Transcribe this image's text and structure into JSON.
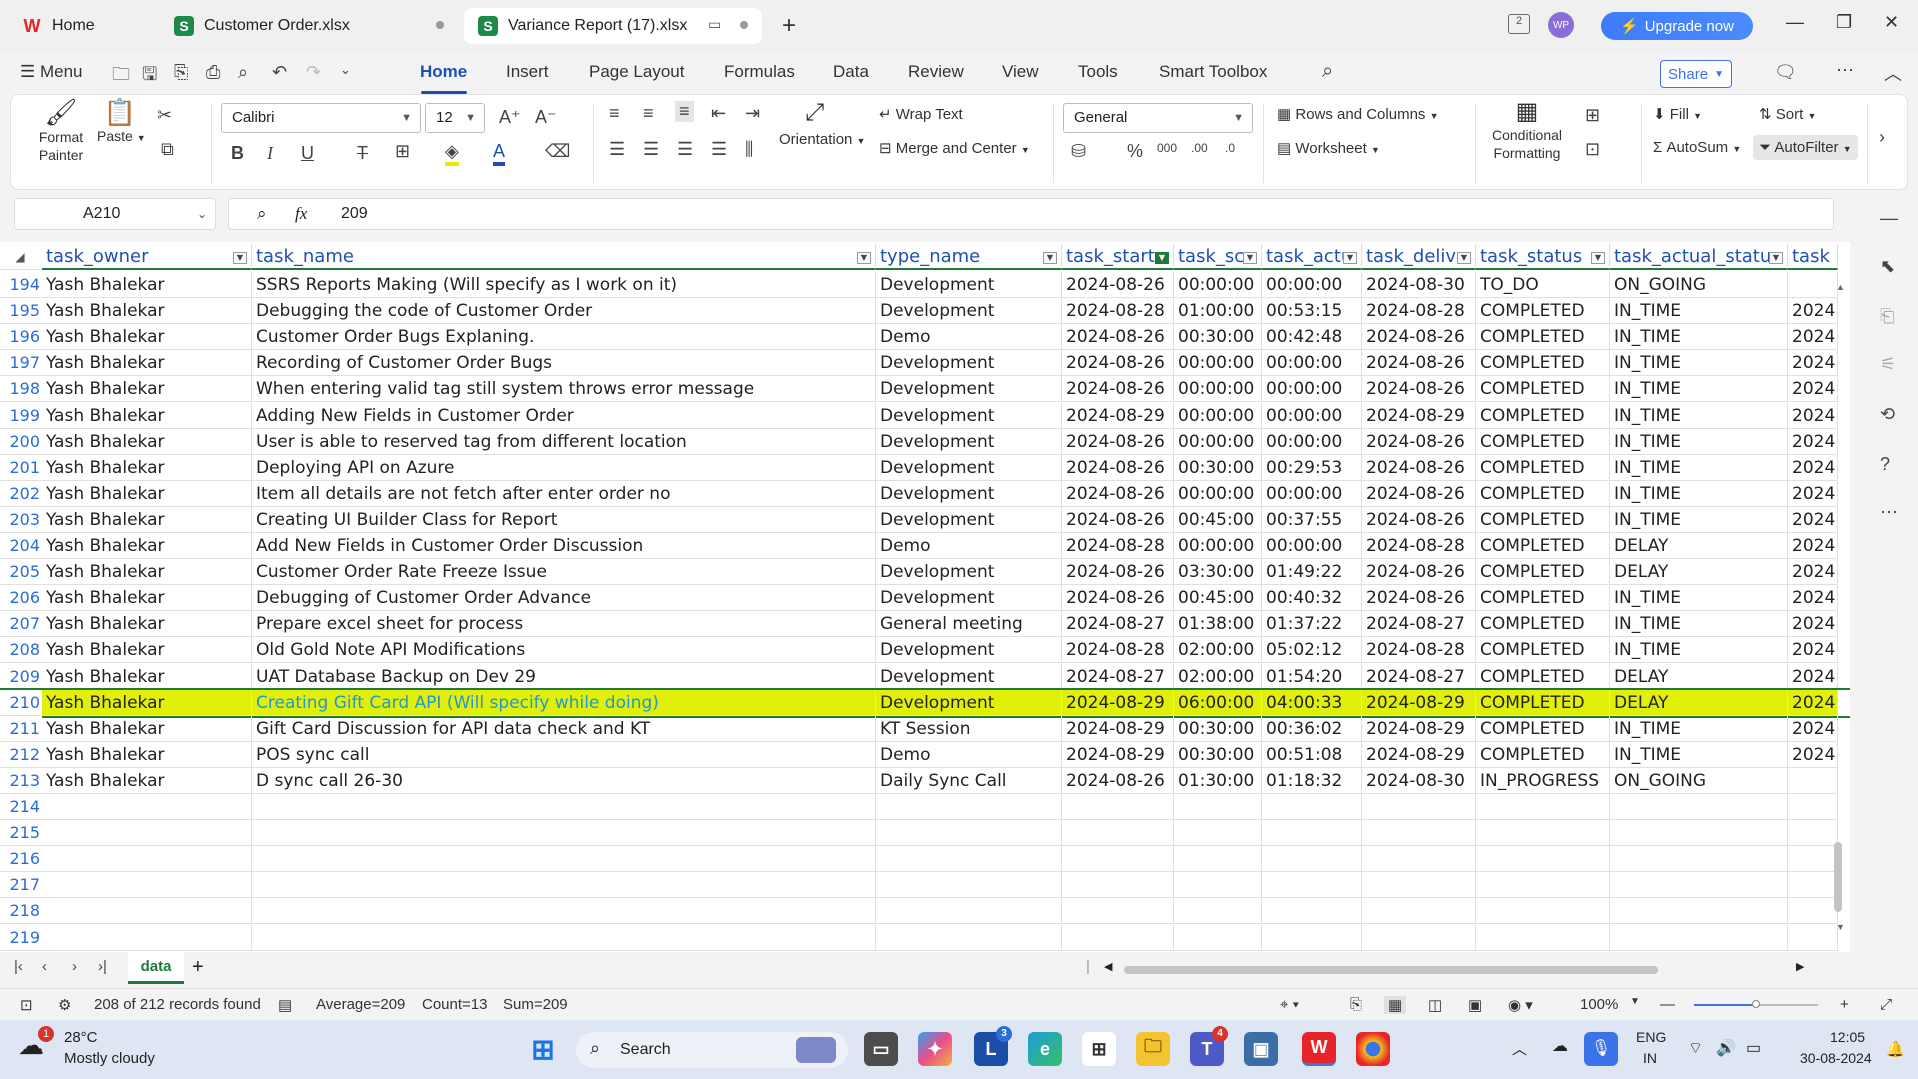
{
  "window": {
    "tabs": [
      {
        "label": "Home",
        "icon": "wps-logo-icon"
      },
      {
        "label": "Customer Order.xlsx",
        "icon": "sheet-icon"
      },
      {
        "label": "Variance Report (17).xlsx",
        "icon": "sheet-icon"
      }
    ],
    "upgrade_label": "Upgrade now",
    "account_initials": "WP"
  },
  "menubar": {
    "menu_label": "Menu",
    "items": [
      "Home",
      "Insert",
      "Page Layout",
      "Formulas",
      "Data",
      "Review",
      "View",
      "Tools",
      "Smart Toolbox"
    ],
    "share_label": "Share"
  },
  "ribbon": {
    "format_painter": "Format Painter",
    "paste": "Paste",
    "font_name": "Calibri",
    "font_size": "12",
    "wrap_text": "Wrap Text",
    "merge_center": "Merge and Center",
    "orientation": "Orientation",
    "number_format": "General",
    "rows_columns": "Rows and Columns",
    "worksheet": "Worksheet",
    "conditional_formatting": "Conditional Formatting",
    "fill": "Fill",
    "autosum": "AutoSum",
    "sort": "Sort",
    "autofilter": "AutoFilter"
  },
  "formula_bar": {
    "cell_ref": "A210",
    "fx": "fx",
    "value": "209"
  },
  "columns": [
    {
      "label": "task_owner",
      "filter": false
    },
    {
      "label": "task_name",
      "filter": false
    },
    {
      "label": "type_name",
      "filter": false
    },
    {
      "label": "task_start",
      "filter": true
    },
    {
      "label": "task_sc",
      "filter": false
    },
    {
      "label": "task_actu",
      "filter": false
    },
    {
      "label": "task_deliv",
      "filter": false
    },
    {
      "label": "task_status",
      "filter": false
    },
    {
      "label": "task_actual_status",
      "filter": false
    },
    {
      "label": "task",
      "filter": false
    }
  ],
  "rows": [
    {
      "n": "194",
      "c": [
        "Yash Bhalekar",
        "SSRS Reports Making (Will specify as I work on it)",
        "Development",
        "2024-08-26",
        "00:00:00",
        "00:00:00",
        "2024-08-30",
        "TO_DO",
        "ON_GOING",
        ""
      ]
    },
    {
      "n": "195",
      "c": [
        "Yash Bhalekar",
        "Debugging the code of Customer Order",
        "Development",
        "2024-08-28",
        "01:00:00",
        "00:53:15",
        "2024-08-28",
        "COMPLETED",
        "IN_TIME",
        "2024"
      ]
    },
    {
      "n": "196",
      "c": [
        "Yash Bhalekar",
        "Customer Order Bugs Explaning.",
        "Demo",
        "2024-08-26",
        "00:30:00",
        "00:42:48",
        "2024-08-26",
        "COMPLETED",
        "IN_TIME",
        "2024"
      ]
    },
    {
      "n": "197",
      "c": [
        "Yash Bhalekar",
        "Recording of Customer Order Bugs",
        "Development",
        "2024-08-26",
        "00:00:00",
        "00:00:00",
        "2024-08-26",
        "COMPLETED",
        "IN_TIME",
        "2024"
      ]
    },
    {
      "n": "198",
      "c": [
        "Yash Bhalekar",
        "When entering valid tag still system throws error message",
        "Development",
        "2024-08-26",
        "00:00:00",
        "00:00:00",
        "2024-08-26",
        "COMPLETED",
        "IN_TIME",
        "2024"
      ]
    },
    {
      "n": "199",
      "c": [
        "Yash Bhalekar",
        "Adding New Fields in Customer Order",
        "Development",
        "2024-08-29",
        "00:00:00",
        "00:00:00",
        "2024-08-29",
        "COMPLETED",
        "IN_TIME",
        "2024"
      ]
    },
    {
      "n": "200",
      "c": [
        "Yash Bhalekar",
        "User is able to reserved tag from  different  location",
        "Development",
        "2024-08-26",
        "00:00:00",
        "00:00:00",
        "2024-08-26",
        "COMPLETED",
        "IN_TIME",
        "2024"
      ]
    },
    {
      "n": "201",
      "c": [
        "Yash Bhalekar",
        "Deploying API on Azure",
        "Development",
        "2024-08-26",
        "00:30:00",
        "00:29:53",
        "2024-08-26",
        "COMPLETED",
        "IN_TIME",
        "2024"
      ]
    },
    {
      "n": "202",
      "c": [
        "Yash Bhalekar",
        "Item all details are not fetch  after enter order no",
        "Development",
        "2024-08-26",
        "00:00:00",
        "00:00:00",
        "2024-08-26",
        "COMPLETED",
        "IN_TIME",
        "2024"
      ]
    },
    {
      "n": "203",
      "c": [
        "Yash Bhalekar",
        "Creating UI Builder Class for Report",
        "Development",
        "2024-08-26",
        "00:45:00",
        "00:37:55",
        "2024-08-26",
        "COMPLETED",
        "IN_TIME",
        "2024"
      ]
    },
    {
      "n": "204",
      "c": [
        "Yash Bhalekar",
        "Add New Fields in Customer Order Discussion",
        "Demo",
        "2024-08-28",
        "00:00:00",
        "00:00:00",
        "2024-08-28",
        "COMPLETED",
        "DELAY",
        "2024"
      ]
    },
    {
      "n": "205",
      "c": [
        "Yash Bhalekar",
        "Customer Order Rate Freeze Issue",
        "Development",
        "2024-08-26",
        "03:30:00",
        "01:49:22",
        "2024-08-26",
        "COMPLETED",
        "DELAY",
        "2024"
      ]
    },
    {
      "n": "206",
      "c": [
        "Yash Bhalekar",
        "Debugging of Customer Order Advance",
        "Development",
        "2024-08-26",
        "00:45:00",
        "00:40:32",
        "2024-08-26",
        "COMPLETED",
        "IN_TIME",
        "2024"
      ]
    },
    {
      "n": "207",
      "c": [
        "Yash Bhalekar",
        "Prepare excel sheet for process",
        "General meeting",
        "2024-08-27",
        "01:38:00",
        "01:37:22",
        "2024-08-27",
        "COMPLETED",
        "IN_TIME",
        "2024"
      ]
    },
    {
      "n": "208",
      "c": [
        "Yash Bhalekar",
        "Old Gold Note API Modifications",
        "Development",
        "2024-08-28",
        "02:00:00",
        "05:02:12",
        "2024-08-28",
        "COMPLETED",
        "IN_TIME",
        "2024"
      ]
    },
    {
      "n": "209",
      "c": [
        "Yash Bhalekar",
        "UAT Database Backup on Dev 29",
        "Development",
        "2024-08-27",
        "02:00:00",
        "01:54:20",
        "2024-08-27",
        "COMPLETED",
        "DELAY",
        "2024"
      ]
    },
    {
      "n": "210",
      "c": [
        "Yash Bhalekar",
        "Creating Gift Card API (Will specify while doing)",
        "Development",
        "2024-08-29",
        "06:00:00",
        "04:00:33",
        "2024-08-29",
        "COMPLETED",
        "DELAY",
        "2024"
      ],
      "selected": true
    },
    {
      "n": "211",
      "c": [
        "Yash Bhalekar",
        "Gift Card Discussion for API data check and KT",
        "KT Session",
        "2024-08-29",
        "00:30:00",
        "00:36:02",
        "2024-08-29",
        "COMPLETED",
        "IN_TIME",
        "2024"
      ]
    },
    {
      "n": "212",
      "c": [
        "Yash Bhalekar",
        "POS sync call",
        "Demo",
        "2024-08-29",
        "00:30:00",
        "00:51:08",
        "2024-08-29",
        "COMPLETED",
        "IN_TIME",
        "2024"
      ]
    },
    {
      "n": "213",
      "c": [
        "Yash Bhalekar",
        "D sync call 26-30",
        "Daily Sync Call",
        "2024-08-26",
        "01:30:00",
        "01:18:32",
        "2024-08-30",
        "IN_PROGRESS",
        "ON_GOING",
        ""
      ]
    },
    {
      "n": "214",
      "c": [
        "",
        "",
        "",
        "",
        "",
        "",
        "",
        "",
        "",
        ""
      ]
    },
    {
      "n": "215",
      "c": [
        "",
        "",
        "",
        "",
        "",
        "",
        "",
        "",
        "",
        ""
      ]
    },
    {
      "n": "216",
      "c": [
        "",
        "",
        "",
        "",
        "",
        "",
        "",
        "",
        "",
        ""
      ]
    },
    {
      "n": "217",
      "c": [
        "",
        "",
        "",
        "",
        "",
        "",
        "",
        "",
        "",
        ""
      ]
    },
    {
      "n": "218",
      "c": [
        "",
        "",
        "",
        "",
        "",
        "",
        "",
        "",
        "",
        ""
      ]
    },
    {
      "n": "219",
      "c": [
        "",
        "",
        "",
        "",
        "",
        "",
        "",
        "",
        "",
        ""
      ]
    }
  ],
  "sheet_tabs": {
    "active": "data",
    "add": "+"
  },
  "status": {
    "records": "208 of 212 records found",
    "average": "Average=209",
    "count": "Count=13",
    "sum": "Sum=209",
    "zoom": "100%"
  },
  "taskbar": {
    "weather_temp": "28°C",
    "weather_desc": "Mostly cloudy",
    "weather_badge": "1",
    "search": "Search",
    "lang1": "ENG",
    "lang2": "IN",
    "time": "12:05",
    "date": "30-08-2024",
    "l_badge": "3",
    "teams_badge": "4"
  },
  "colors": {
    "accent": "#1a4fb8",
    "selection": "#e2ef08",
    "header_border": "#1f7a3a",
    "upgrade": "#3e7bfa"
  }
}
